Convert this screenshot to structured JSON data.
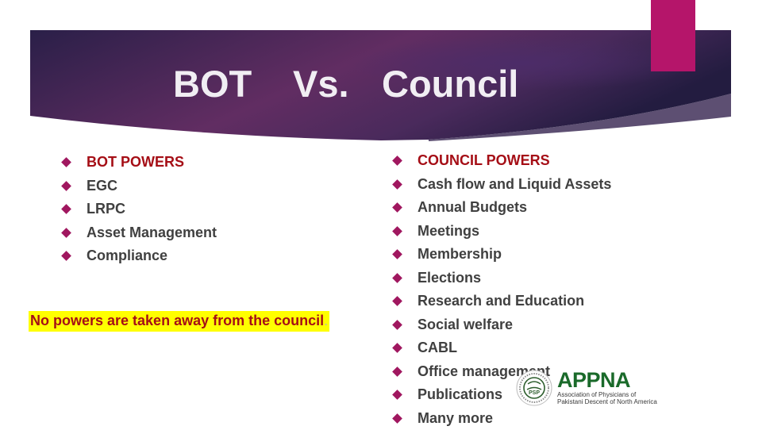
{
  "slide": {
    "title_parts": [
      "BOT",
      "Vs.",
      "Council"
    ],
    "colors": {
      "banner_dark": "#2b1f47",
      "banner_purple": "#632e63",
      "accent_pink": "#b5156a",
      "bullet": "#a0175f",
      "heading_red": "#a50e16",
      "body_text": "#404040",
      "highlight": "#ffff00",
      "logo_green": "#1a6a2a"
    },
    "bullet_icon": "diamond-bullet-icon"
  },
  "left_column": {
    "items": [
      {
        "label": "BOT POWERS",
        "heading": true
      },
      {
        "label": "EGC"
      },
      {
        "label": "LRPC"
      },
      {
        "label": "Asset Management"
      },
      {
        "label": "Compliance"
      }
    ],
    "note": "No powers are taken away from the council",
    "note_end": "."
  },
  "right_column": {
    "items": [
      {
        "label": "COUNCIL POWERS",
        "heading": true
      },
      {
        "label": "Cash flow and Liquid Assets"
      },
      {
        "label": "Annual Budgets"
      },
      {
        "label": "Meetings"
      },
      {
        "label": "Membership"
      },
      {
        "label": "Elections"
      },
      {
        "label": "Research and Education"
      },
      {
        "label": "Social welfare"
      },
      {
        "label": "CABL"
      },
      {
        "label": "Office management"
      },
      {
        "label": "Publications"
      },
      {
        "label": "Many more"
      }
    ]
  },
  "logo": {
    "seal_letters": "PSP",
    "name": "APPNA",
    "subtitle_line1": "Association of Physicians of",
    "subtitle_line2": "Pakistani Descent of North America"
  }
}
